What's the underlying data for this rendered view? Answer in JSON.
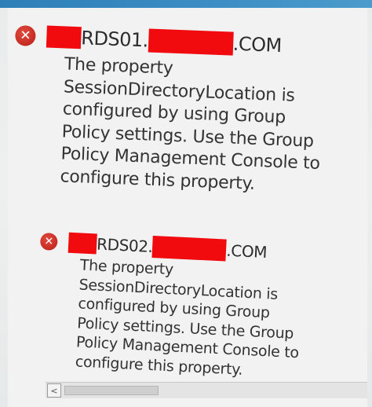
{
  "errors": [
    {
      "icon": "error-circle-icon",
      "icon_glyph": "✕",
      "host_middle": "RDS01.",
      "host_suffix": ".COM",
      "message_lines": [
        "The property",
        "SessionDirectoryLocation is",
        "configured by using Group",
        "Policy settings. Use the Group",
        "Policy Management Console to",
        "configure this property."
      ]
    },
    {
      "icon": "error-circle-icon",
      "icon_glyph": "✕",
      "host_middle": "RDS02.",
      "host_suffix": ".COM",
      "message_lines": [
        "The property",
        "SessionDirectoryLocation is",
        "configured by using Group",
        "Policy settings. Use the Group",
        "Policy Management Console to",
        "configure this property."
      ]
    }
  ],
  "scrollbar": {
    "left_arrow": "<"
  },
  "colors": {
    "error_red": "#c62b22",
    "redaction_red": "#f10a0e",
    "accent_blue": "#2e7fb8"
  }
}
